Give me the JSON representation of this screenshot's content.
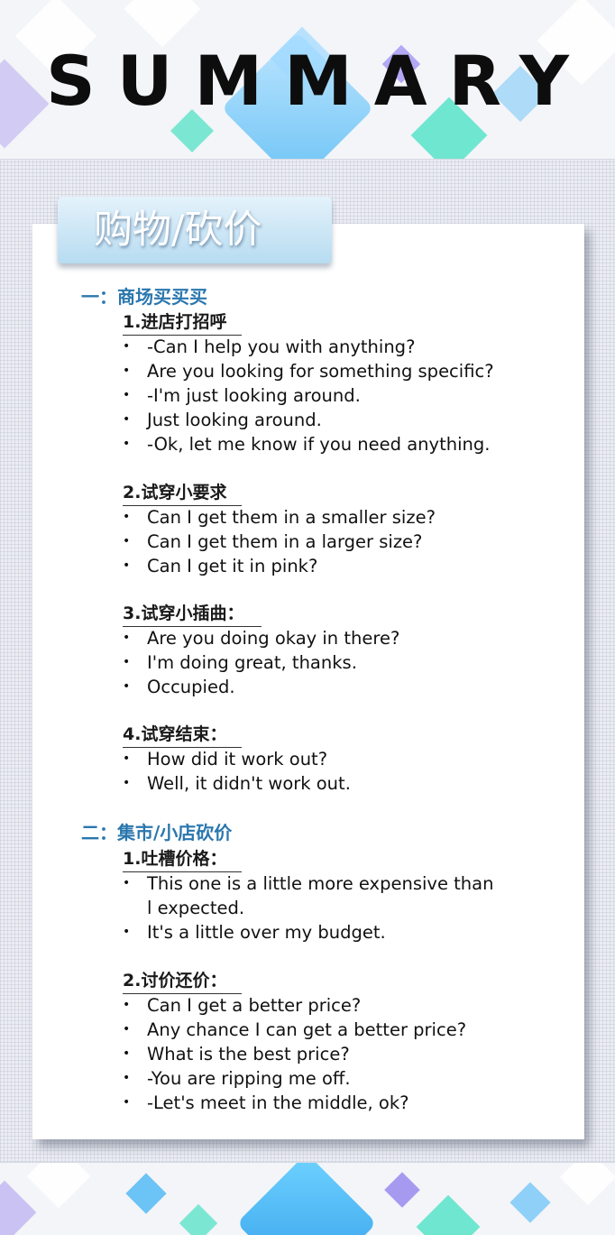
{
  "header": {
    "title": "SUMMARY"
  },
  "section_tab": {
    "title": "购物/砍价"
  },
  "sections": [
    {
      "heading": "一：商场买买买",
      "subsections": [
        {
          "heading": "1.进店打招呼",
          "items": [
            "-Can I help you with anything?",
            "Are you looking for something specific?",
            "-I'm just looking around.",
            "Just looking around.",
            "-Ok, let me know if you need anything."
          ]
        },
        {
          "heading": "2.试穿小要求",
          "items": [
            "Can I get them in a smaller size?",
            "Can I get them in a larger size?",
            "Can I get it in pink?"
          ]
        },
        {
          "heading": "3.试穿小插曲：",
          "items": [
            "Are you doing okay in there?",
            "I'm doing great, thanks.",
            "Occupied."
          ]
        },
        {
          "heading": "4.试穿结束：",
          "items": [
            "How did it work out?",
            "Well, it didn't work out."
          ]
        }
      ]
    },
    {
      "heading": "二：集市/小店砍价",
      "subsections": [
        {
          "heading": "1.吐槽价格：",
          "items": [
            "This one is a little more expensive than",
            "l expected.",
            "It's a little over my budget."
          ]
        },
        {
          "heading": "2.讨价还价：",
          "items": [
            "Can I get a better price?",
            "Any chance I can get a better price?",
            "What is the best price?",
            "-You are ripping me off.",
            "-Let's meet in the middle, ok?"
          ]
        }
      ]
    }
  ],
  "colors": {
    "accent": "#2a77ae",
    "tab_gradient_top": "#e4f2fb",
    "tab_gradient_bottom": "#b7dcf1",
    "gem_blue": "#4fb6f0",
    "gem_purple": "#a69af0",
    "gem_mint": "#6fe6cf"
  },
  "icons": {
    "bullet": "bullet-dot-icon"
  }
}
